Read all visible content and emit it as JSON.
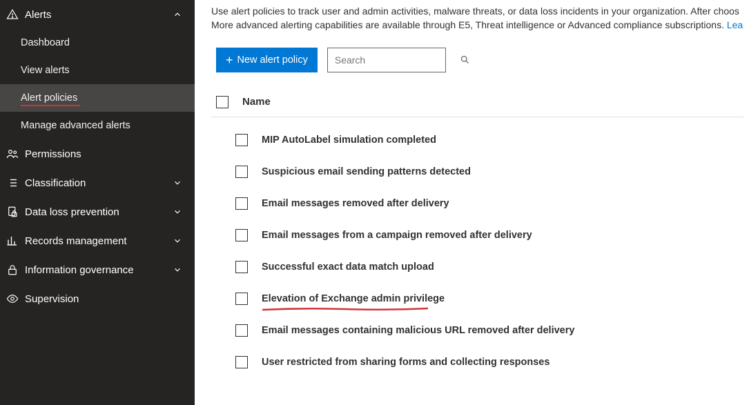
{
  "sidebar": {
    "alerts": {
      "label": "Alerts",
      "expanded": true,
      "items": [
        {
          "label": "Dashboard"
        },
        {
          "label": "View alerts"
        },
        {
          "label": "Alert policies",
          "active": true,
          "underlined": true
        },
        {
          "label": "Manage advanced alerts"
        }
      ]
    },
    "sections": [
      {
        "label": "Permissions",
        "icon": "people",
        "expandable": false
      },
      {
        "label": "Classification",
        "icon": "list",
        "expandable": true
      },
      {
        "label": "Data loss prevention",
        "icon": "lock-doc",
        "expandable": true
      },
      {
        "label": "Records management",
        "icon": "chart",
        "expandable": true
      },
      {
        "label": "Information governance",
        "icon": "lock",
        "expandable": true
      },
      {
        "label": "Supervision",
        "icon": "eye",
        "expandable": false
      }
    ]
  },
  "intro": {
    "line1": "Use alert policies to track user and admin activities, malware threats, or data loss incidents in your organization. After choos",
    "line2_a": "More advanced alerting capabilities are available through E5, Threat intelligence or Advanced compliance subscriptions. ",
    "line2_link": "Lea"
  },
  "toolbar": {
    "new_policy_label": "New alert policy",
    "search_placeholder": "Search"
  },
  "list": {
    "header": "Name",
    "rows": [
      {
        "name": "MIP AutoLabel simulation completed"
      },
      {
        "name": "Suspicious email sending patterns detected"
      },
      {
        "name": "Email messages removed after delivery"
      },
      {
        "name": "Email messages from a campaign removed after delivery"
      },
      {
        "name": "Successful exact data match upload"
      },
      {
        "name": "Elevation of Exchange admin privilege",
        "highlighted": true
      },
      {
        "name": "Email messages containing malicious URL removed after delivery"
      },
      {
        "name": "User restricted from sharing forms and collecting responses"
      }
    ]
  }
}
